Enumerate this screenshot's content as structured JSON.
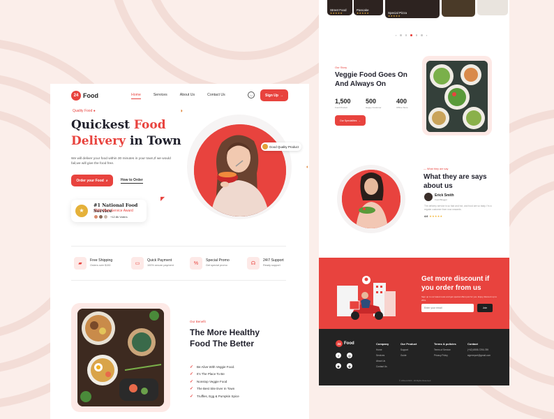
{
  "colors": {
    "brand": "#e8433e",
    "dark": "#1f1f2b",
    "background": "#fbeeea",
    "footer": "#232323"
  },
  "brand": {
    "badge": "24",
    "name": "Food"
  },
  "nav": {
    "links": [
      "Home",
      "Services",
      "About Us",
      "Contact Us"
    ],
    "cart_icon": "bag-icon",
    "signup_label": "Sign Up"
  },
  "hero": {
    "tag": "Quality Food",
    "title_part1": "Quickest",
    "title_part2": "Food",
    "title_part3": "Delivery",
    "title_part4": "in Town",
    "description": "We will deliver your food within 30 minutes in your town,If we would fail,we will give the food free.",
    "order_button": "Order your Food",
    "howto_link": "How to Order",
    "quality_pill": "Good Quality Product",
    "award": {
      "title": "#1 National Food Service",
      "subtitle": "2021 Best Service Award",
      "voters": "+12.8k Voters"
    }
  },
  "features": [
    {
      "icon": "truck-icon",
      "title": "Free Shipping",
      "subtitle": "Orders over $150"
    },
    {
      "icon": "card-icon",
      "title": "Quick Payment",
      "subtitle": "100% secure payment"
    },
    {
      "icon": "percent-icon",
      "title": "Special Promo",
      "subtitle": "Get special promo"
    },
    {
      "icon": "headset-icon",
      "title": "24/7 Support",
      "subtitle": "Ready support"
    }
  ],
  "benefit": {
    "tag": "Our Benefit",
    "title_line1": "The More Healthy",
    "title_line2": "Food The Better",
    "items": [
      "Be Alive With Veggie Food.",
      "It's The Place To Be",
      "Nonstop Veggie Food",
      "The Best Site Ever In Town",
      "Truffles, Egg & Pumpkin Spice"
    ]
  },
  "top_cards": [
    {
      "label": "Street Food",
      "stars": "★★★★★"
    },
    {
      "label": "Pancake",
      "stars": "★★★★★"
    },
    {
      "label": "Special Pizza",
      "stars": "★★★★★"
    },
    {
      "label": "",
      "stars": ""
    },
    {
      "label": "",
      "stars": ""
    }
  ],
  "veggie": {
    "tag": "Our Story",
    "title_line1": "Veggie Food Goes On",
    "title_line2": "And Always On",
    "stats": [
      {
        "num": "1,500",
        "label": "Food Product"
      },
      {
        "num": "500",
        "label": "Happy Customer"
      },
      {
        "num": "400",
        "label": "Offline Store"
      }
    ],
    "explore_button": "Our Specialities"
  },
  "testimonial": {
    "tag": "What they are say",
    "title_line1": "What they are says",
    "title_line2": "about us",
    "name": "Erick Smith",
    "role": "Food Blogger",
    "text": "The delivery service is so fast and hot, and food are so tasty. I'm a regular customer from now onwards.",
    "rating": "4.6",
    "stars": "★★★★★"
  },
  "discount": {
    "title_line1": "Get more discount if",
    "title_line2": "you order from us",
    "description": "Sign up to our latest news and get special offers just for you. Enjoy discount up to 25%.",
    "email_placeholder": "Enter your email",
    "button": "Join"
  },
  "footer": {
    "columns": [
      {
        "head": "Company",
        "items": [
          "Home",
          "Services",
          "About Us",
          "Contact Us"
        ]
      },
      {
        "head": "Our Product",
        "items": [
          "Support",
          "Guide"
        ]
      },
      {
        "head": "Terms & policies",
        "items": [
          "Terms of Service",
          "Privacy Policy"
        ]
      },
      {
        "head": "Contact",
        "items": [
          "(+62) 8555-7290-789",
          "sigerreport@gmail.com"
        ]
      }
    ],
    "copyright": "© 24food 2022 - All Rights Reserved"
  }
}
